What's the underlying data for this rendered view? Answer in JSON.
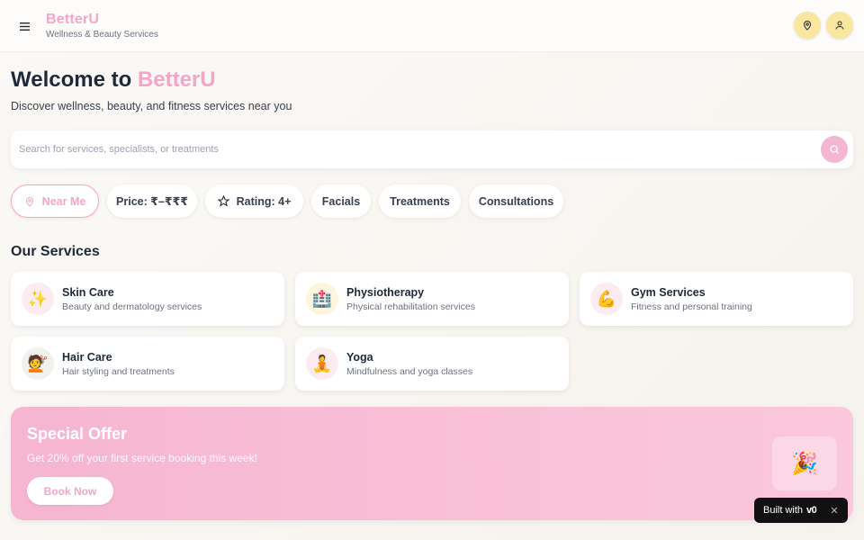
{
  "header": {
    "brand": "BetterU",
    "tagline": "Wellness & Beauty Services"
  },
  "hero": {
    "title_prefix": "Welcome to ",
    "title_accent": "BetterU",
    "subtitle": "Discover wellness, beauty, and fitness services near you"
  },
  "search": {
    "placeholder": "Search for services, specialists, or treatments",
    "value": ""
  },
  "filters": [
    {
      "label": "Near Me",
      "icon": "map-pin-icon",
      "active": true
    },
    {
      "label": "Price: ₹–₹₹₹",
      "active": false
    },
    {
      "label": "Rating: 4+",
      "icon": "star-icon",
      "active": false
    },
    {
      "label": "Facials",
      "active": false
    },
    {
      "label": "Treatments",
      "active": false
    },
    {
      "label": "Consultations",
      "active": false
    }
  ],
  "services": {
    "title": "Our Services",
    "items": [
      {
        "title": "Skin Care",
        "desc": "Beauty and dermatology services",
        "icon": "✨",
        "bg": "#fdecef"
      },
      {
        "title": "Physiotherapy",
        "desc": "Physical rehabilitation services",
        "icon": "🏥",
        "bg": "#fdf6dc"
      },
      {
        "title": "Gym Services",
        "desc": "Fitness and personal training",
        "icon": "💪",
        "bg": "#fdecef"
      },
      {
        "title": "Hair Care",
        "desc": "Hair styling and treatments",
        "icon": "💇",
        "bg": "#f3f1ee"
      },
      {
        "title": "Yoga",
        "desc": "Mindfulness and yoga classes",
        "icon": "🧘",
        "bg": "#fdecef"
      }
    ]
  },
  "offer": {
    "title": "Special Offer",
    "subtitle": "Get 20% off your first service booking this week!",
    "button": "Book Now",
    "badge": "🎉"
  },
  "built": {
    "label": "Built with",
    "brand": "v0"
  },
  "colors": {
    "accent": "#f4a6c9",
    "header_icon_bg": "#f9e79f"
  }
}
